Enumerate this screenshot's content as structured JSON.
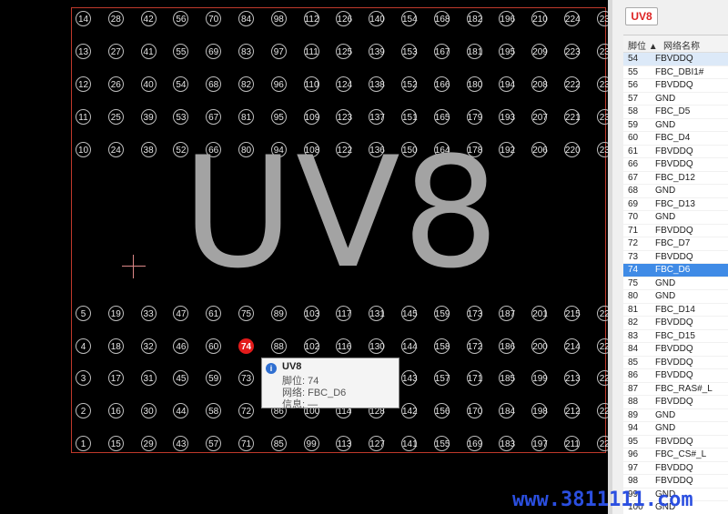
{
  "part_name": "UV8",
  "canvas": {
    "big_label": "UV8",
    "highlight_pin": "74",
    "top_rows": [
      [
        "14",
        "28",
        "42",
        "56",
        "70",
        "84",
        "98",
        "112",
        "126",
        "140",
        "154",
        "168",
        "182",
        "196",
        "210",
        "224",
        "23"
      ],
      [
        "13",
        "27",
        "41",
        "55",
        "69",
        "83",
        "97",
        "111",
        "125",
        "139",
        "153",
        "167",
        "181",
        "195",
        "209",
        "223",
        "23"
      ],
      [
        "12",
        "26",
        "40",
        "54",
        "68",
        "82",
        "96",
        "110",
        "124",
        "138",
        "152",
        "166",
        "180",
        "194",
        "208",
        "222",
        "23"
      ],
      [
        "11",
        "25",
        "39",
        "53",
        "67",
        "81",
        "95",
        "109",
        "123",
        "137",
        "151",
        "165",
        "179",
        "193",
        "207",
        "221",
        "23"
      ],
      [
        "10",
        "24",
        "38",
        "52",
        "66",
        "80",
        "94",
        "108",
        "122",
        "136",
        "150",
        "164",
        "178",
        "192",
        "206",
        "220",
        "23"
      ]
    ],
    "bottom_rows": [
      [
        "5",
        "19",
        "33",
        "47",
        "61",
        "75",
        "89",
        "103",
        "117",
        "131",
        "145",
        "159",
        "173",
        "187",
        "201",
        "215",
        "22"
      ],
      [
        "4",
        "18",
        "32",
        "46",
        "60",
        "74",
        "88",
        "102",
        "116",
        "130",
        "144",
        "158",
        "172",
        "186",
        "200",
        "214",
        "22"
      ],
      [
        "3",
        "17",
        "31",
        "45",
        "59",
        "73",
        "",
        "",
        "",
        "",
        "143",
        "157",
        "171",
        "185",
        "199",
        "213",
        "22"
      ],
      [
        "2",
        "16",
        "30",
        "44",
        "58",
        "72",
        "86",
        "100",
        "114",
        "128",
        "142",
        "156",
        "170",
        "184",
        "198",
        "212",
        "22"
      ],
      [
        "1",
        "15",
        "29",
        "43",
        "57",
        "71",
        "85",
        "99",
        "113",
        "127",
        "141",
        "155",
        "169",
        "183",
        "197",
        "211",
        "22"
      ]
    ]
  },
  "tooltip": {
    "title": "UV8",
    "pin_line": "脚位: 74",
    "net_line": "网络: FBC_D6",
    "info_line": "信息: —"
  },
  "panel": {
    "part_button_label": "UV8",
    "col_pin": "脚位 ▲",
    "col_net": "网络名称",
    "rows": [
      [
        "54",
        "FBVDDQ"
      ],
      [
        "55",
        "FBC_DBI1#"
      ],
      [
        "56",
        "FBVDDQ"
      ],
      [
        "57",
        "GND"
      ],
      [
        "58",
        "FBC_D5"
      ],
      [
        "59",
        "GND"
      ],
      [
        "60",
        "FBC_D4"
      ],
      [
        "61",
        "FBVDDQ"
      ],
      [
        "66",
        "FBVDDQ"
      ],
      [
        "67",
        "FBC_D12"
      ],
      [
        "68",
        "GND"
      ],
      [
        "69",
        "FBC_D13"
      ],
      [
        "70",
        "GND"
      ],
      [
        "71",
        "FBVDDQ"
      ],
      [
        "72",
        "FBC_D7"
      ],
      [
        "73",
        "FBVDDQ"
      ],
      [
        "74",
        "FBC_D6"
      ],
      [
        "75",
        "GND"
      ],
      [
        "80",
        "GND"
      ],
      [
        "81",
        "FBC_D14"
      ],
      [
        "82",
        "FBVDDQ"
      ],
      [
        "83",
        "FBC_D15"
      ],
      [
        "84",
        "FBVDDQ"
      ],
      [
        "85",
        "FBVDDQ"
      ],
      [
        "86",
        "FBVDDQ"
      ],
      [
        "87",
        "FBC_RAS#_L"
      ],
      [
        "88",
        "FBVDDQ"
      ],
      [
        "89",
        "GND"
      ],
      [
        "94",
        "GND"
      ],
      [
        "95",
        "FBVDDQ"
      ],
      [
        "96",
        "FBC_CS#_L"
      ],
      [
        "97",
        "FBVDDQ"
      ],
      [
        "98",
        "FBVDDQ"
      ],
      [
        "99",
        "GND"
      ],
      [
        "100",
        "GND"
      ]
    ],
    "selected_pin": "74"
  },
  "watermark": "www.3811111.com"
}
